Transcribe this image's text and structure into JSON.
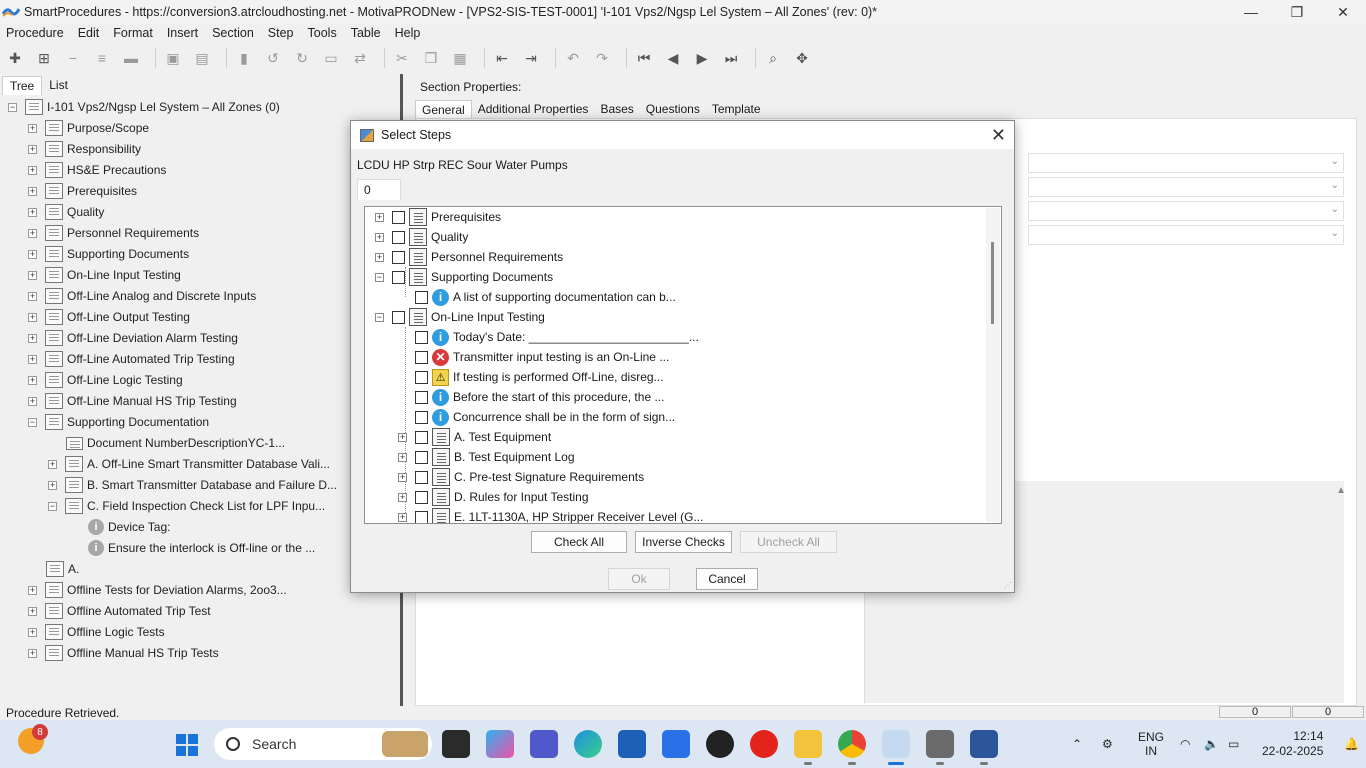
{
  "window": {
    "title": "SmartProcedures - https://conversion3.atrcloudhosting.net - MotivaPRODNew - [VPS2-SIS-TEST-0001] 'I-101 Vps2/Ngsp Lel System – All Zones' (rev: 0)*",
    "minimize": "—",
    "restore": "❐",
    "close": "✕"
  },
  "menu": [
    "Procedure",
    "Edit",
    "Format",
    "Insert",
    "Section",
    "Step",
    "Tools",
    "Table",
    "Help"
  ],
  "left_tabs": [
    "Tree",
    "List"
  ],
  "tree": {
    "root": "I-101 Vps2/Ngsp Lel System – All Zones (0)",
    "items": [
      "Purpose/Scope",
      "Responsibility",
      "HS&E Precautions",
      "Prerequisites",
      "Quality",
      "Personnel Requirements",
      "Supporting Documents",
      "On-Line Input Testing",
      "Off-Line Analog and Discrete Inputs",
      "Off-Line Output Testing",
      "Off-Line Deviation Alarm Testing",
      "Off-Line Automated Trip Testing",
      "Off-Line Logic Testing",
      "Off-Line Manual HS Trip Testing",
      "Supporting Documentation"
    ],
    "sub_items": [
      "Document NumberDescriptionYC-1...",
      "A. Off-Line Smart Transmitter Database Vali...",
      "B. Smart Transmitter Database and Failure D...",
      "C. Field Inspection Check List for LPF Inpu..."
    ],
    "sub_sub_items": [
      "Device Tag:",
      "Ensure the interlock is Off-line or the ..."
    ],
    "after_items": [
      "A.",
      "Offline Tests for Deviation Alarms, 2oo3...",
      "Offline Automated Trip Test",
      "Offline Logic Tests",
      "Offline Manual HS Trip Tests"
    ]
  },
  "right": {
    "section_label": "Section Properties:",
    "tabs": [
      "General",
      "Additional Properties",
      "Bases",
      "Questions",
      "Template"
    ]
  },
  "dialog": {
    "title": "Select Steps",
    "heading": "LCDU HP Strp REC Sour Water Pumps",
    "count": "0",
    "rows": [
      {
        "label": "Prerequisites",
        "icon": "page"
      },
      {
        "label": "Quality",
        "icon": "page"
      },
      {
        "label": "Personnel Requirements",
        "icon": "page"
      },
      {
        "label": "Supporting Documents",
        "icon": "page"
      },
      {
        "label": "A list of supporting documentation can b...",
        "icon": "info"
      },
      {
        "label": "On-Line Input Testing",
        "icon": "page"
      },
      {
        "label": "Today's Date: ________________________...",
        "icon": "info"
      },
      {
        "label": "Transmitter input testing is an On-Line ...",
        "icon": "error"
      },
      {
        "label": "If testing is performed Off-Line, disreg...",
        "icon": "warning"
      },
      {
        "label": "Before the start of this procedure, the ...",
        "icon": "info"
      },
      {
        "label": "Concurrence shall be in the form of sign...",
        "icon": "info"
      },
      {
        "label": "A. Test Equipment",
        "icon": "page"
      },
      {
        "label": "B. Test Equipment Log",
        "icon": "page"
      },
      {
        "label": "C. Pre-test Signature Requirements",
        "icon": "page"
      },
      {
        "label": "D. Rules for Input Testing",
        "icon": "page"
      },
      {
        "label": "E. 1LT-1130A, HP Stripper Receiver Level (G...",
        "icon": "page"
      }
    ],
    "buttons": {
      "check_all": "Check All",
      "inverse": "Inverse Checks",
      "uncheck_all": "Uncheck All",
      "ok": "Ok",
      "cancel": "Cancel"
    }
  },
  "status": {
    "text": "Procedure Retrieved.",
    "box1": "0",
    "box2": "0"
  },
  "taskbar": {
    "weather_badge": "8",
    "search": "Search",
    "lang": "ENG",
    "region": "IN",
    "time": "12:14",
    "date": "22-02-2025"
  },
  "colors": {
    "accent": "#1a73d8",
    "info": "#2f9be0",
    "error": "#d83a3a",
    "warning": "#f2d34a"
  }
}
